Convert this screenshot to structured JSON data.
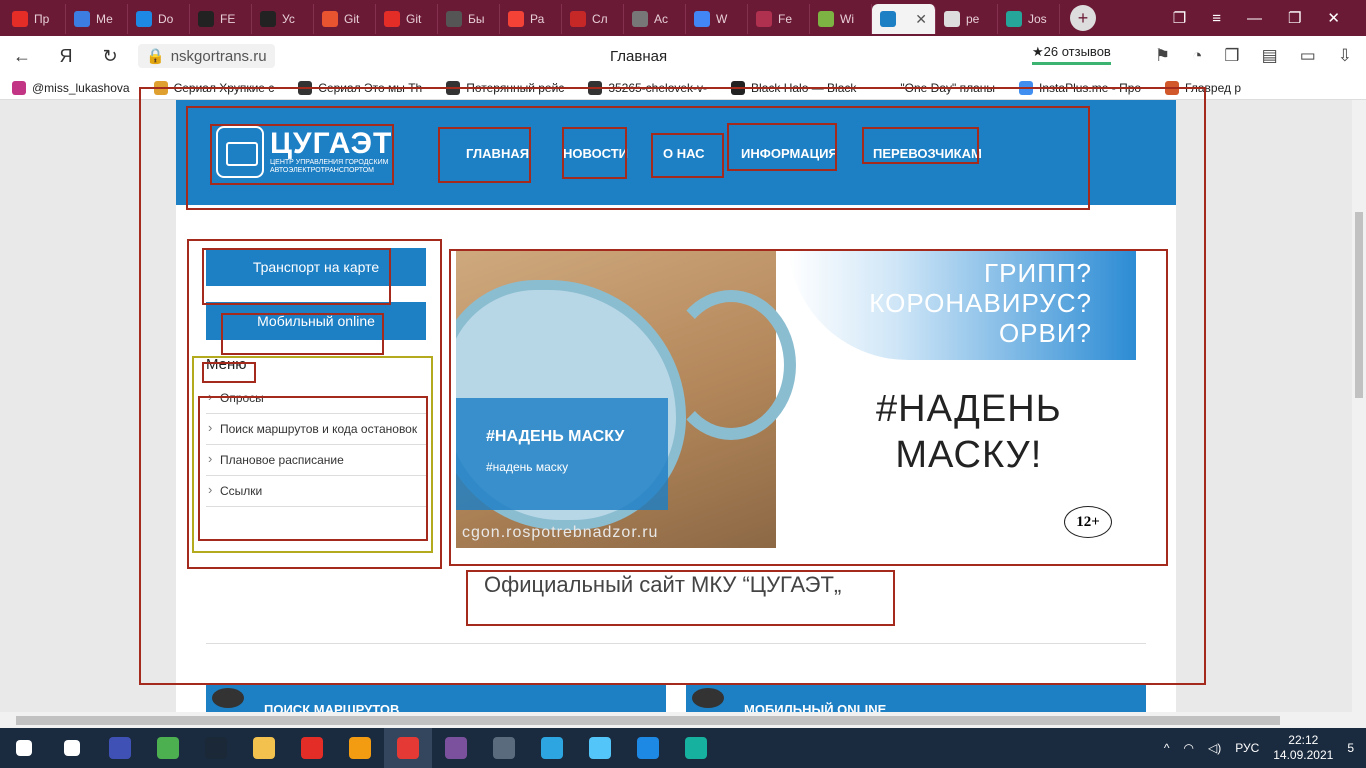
{
  "browser": {
    "tabs": [
      {
        "label": "Пр",
        "color": "#e52d27"
      },
      {
        "label": "Ме",
        "color": "#3b7de0"
      },
      {
        "label": "Do",
        "color": "#1e88e5"
      },
      {
        "label": "FE",
        "color": "#222222"
      },
      {
        "label": "Ус",
        "color": "#222222"
      },
      {
        "label": "Git",
        "color": "#e8542f"
      },
      {
        "label": "Git",
        "color": "#e52d27"
      },
      {
        "label": "Бы",
        "color": "#555555"
      },
      {
        "label": "Ра",
        "color": "#f44336"
      },
      {
        "label": "Сл",
        "color": "#c62828"
      },
      {
        "label": "Ас",
        "color": "#777777"
      },
      {
        "label": "W",
        "color": "#4285f4"
      },
      {
        "label": "Fe",
        "color": "#b0304f"
      },
      {
        "label": "Wi",
        "color": "#7cb342"
      },
      {
        "label": "",
        "color": "#1d7fc4",
        "active": true
      },
      {
        "label": "ре",
        "color": "#dddddd"
      },
      {
        "label": "Jos",
        "color": "#26a69a"
      }
    ],
    "new_tab_symbol": "+",
    "address": "nskgortrans.ru",
    "page_title": "Главная",
    "reviews": "★26 отзывов",
    "bookmarks": [
      {
        "label": "@miss_lukashova",
        "color": "#c13584"
      },
      {
        "label": "Сериал Хрупкие с",
        "color": "#e0a030"
      },
      {
        "label": "Сериал Это мы Th",
        "color": "#333333"
      },
      {
        "label": "Потерянный рейс",
        "color": "#333333"
      },
      {
        "label": "35265-chelovek-v-",
        "color": "#333333"
      },
      {
        "label": "Black Halo — Black",
        "color": "#222222"
      },
      {
        "label": "\"One Day\" планы",
        "color": "#ffffff"
      },
      {
        "label": "InstaPlus.me - Про",
        "color": "#3f8ef0"
      },
      {
        "label": "Главред р",
        "color": "#d0582a"
      }
    ]
  },
  "site": {
    "logo_title": "ЦУГАЭТ",
    "logo_subtitle": "ЦЕНТР УПРАВЛЕНИЯ ГОРОДСКИМ АВТОЭЛЕКТРОТРАНСПОРТОМ",
    "nav": [
      "ГЛАВНАЯ",
      "НОВОСТИ",
      "О НАС",
      "ИНФОРМАЦИЯ",
      "ПЕРЕВОЗЧИКАМ"
    ],
    "side_buttons": [
      "Транспорт на карте",
      "Мобильный online"
    ],
    "menu_title": "Меню",
    "menu_items": [
      "Опросы",
      "Поиск маршрутов и кода остановок",
      "Плановое расписание",
      "Ссылки"
    ],
    "banner": {
      "questions": [
        "ГРИПП?",
        "КОРОНАВИРУС?",
        "ОРВИ?"
      ],
      "slogan": [
        "#НАДЕНЬ",
        "МАСКУ!"
      ],
      "box_title": "#НАДЕНЬ МАСКУ",
      "box_subtitle": "#надень маску",
      "source": "cgon.rospotrebnadzor.ru",
      "age": "12+"
    },
    "official_title": "Официальный сайт МКУ “ЦУГАЭТ„",
    "tiles": [
      "ПОИСК МАРШРУТОВ",
      "МОБИЛЬНЫЙ ONLINE"
    ]
  },
  "taskbar": {
    "apps": [
      {
        "name": "start",
        "color": "#ffffff"
      },
      {
        "name": "search",
        "color": "#ffffff"
      },
      {
        "name": "save",
        "color": "#3f51b5"
      },
      {
        "name": "chrome",
        "color": "#4caf50"
      },
      {
        "name": "steam",
        "color": "#1b2838"
      },
      {
        "name": "explorer",
        "color": "#f2c14e"
      },
      {
        "name": "youtube",
        "color": "#e52d27"
      },
      {
        "name": "sublime",
        "color": "#f39c12"
      },
      {
        "name": "yandex-browser",
        "color": "#e53935"
      },
      {
        "name": "viber",
        "color": "#7b519d"
      },
      {
        "name": "calculator",
        "color": "#5a6b7d"
      },
      {
        "name": "telegram",
        "color": "#2ca5e0"
      },
      {
        "name": "flutter",
        "color": "#54c5f8"
      },
      {
        "name": "vscode",
        "color": "#1e88e5"
      },
      {
        "name": "git-kraken",
        "color": "#17b19f"
      }
    ],
    "lang": "РУС",
    "time": "22:12",
    "date": "14.09.2021",
    "notifications": "5"
  }
}
